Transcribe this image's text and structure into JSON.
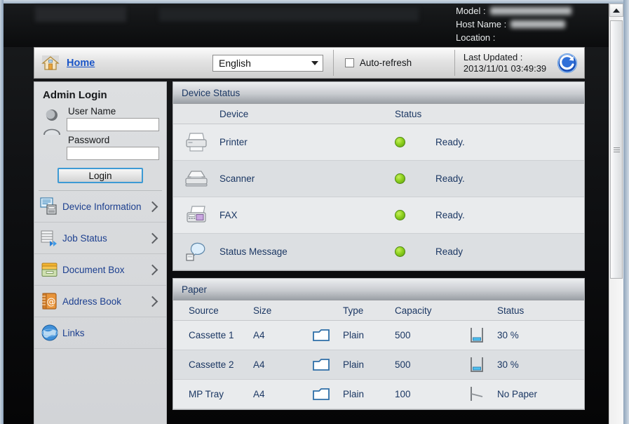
{
  "header": {
    "model_label": "Model :",
    "host_name_label": "Host Name :",
    "location_label": "Location :"
  },
  "toolbar": {
    "home_label": "Home",
    "home_icon": "house-icon",
    "language_value": "English",
    "auto_refresh_label": "Auto-refresh",
    "auto_refresh_checked": false,
    "last_updated_label": "Last Updated :",
    "last_updated_value": "2013/11/01 03:49:39",
    "refresh_icon": "refresh-icon"
  },
  "sidebar": {
    "login": {
      "title": "Admin Login",
      "user_icon": "user-avatar-icon",
      "user_name_label": "User Name",
      "user_name_value": "",
      "password_label": "Password",
      "password_value": "",
      "login_button": "Login"
    },
    "items": [
      {
        "label": "Device Information",
        "icon": "device-information-icon",
        "chevron": true
      },
      {
        "label": "Job Status",
        "icon": "job-status-icon",
        "chevron": true
      },
      {
        "label": "Document Box",
        "icon": "document-box-icon",
        "chevron": true
      },
      {
        "label": "Address Book",
        "icon": "address-book-icon",
        "chevron": true
      },
      {
        "label": "Links",
        "icon": "links-globe-icon",
        "chevron": false
      }
    ]
  },
  "device_status": {
    "panel_title": "Device Status",
    "columns": [
      "Device",
      "Status"
    ],
    "rows": [
      {
        "device": "Printer",
        "icon": "printer-icon",
        "indicator": "green",
        "status": "Ready."
      },
      {
        "device": "Scanner",
        "icon": "scanner-icon",
        "indicator": "green",
        "status": "Ready."
      },
      {
        "device": "FAX",
        "icon": "fax-icon",
        "indicator": "green",
        "status": "Ready."
      },
      {
        "device": "Status Message",
        "icon": "status-message-icon",
        "indicator": "green",
        "status": "Ready"
      }
    ]
  },
  "paper": {
    "panel_title": "Paper",
    "columns": [
      "Source",
      "Size",
      "Type",
      "Capacity",
      "Status"
    ],
    "rows": [
      {
        "source": "Cassette 1",
        "size": "A4",
        "type_icon": "paper-sheet-icon",
        "type": "Plain",
        "capacity": "500",
        "status_icon": "tray-level-icon",
        "status": "30 %"
      },
      {
        "source": "Cassette 2",
        "size": "A4",
        "type_icon": "paper-sheet-icon",
        "type": "Plain",
        "capacity": "500",
        "status_icon": "tray-level-icon",
        "status": "30 %"
      },
      {
        "source": "MP Tray",
        "size": "A4",
        "type_icon": "paper-sheet-icon",
        "type": "Plain",
        "capacity": "100",
        "status_icon": "tray-empty-icon",
        "status": "No Paper"
      }
    ]
  },
  "colors": {
    "link": "#1a55c8",
    "heading_text": "#1b3763",
    "status_ok": "#8fd11f",
    "accent_border": "#3d9ad4"
  }
}
